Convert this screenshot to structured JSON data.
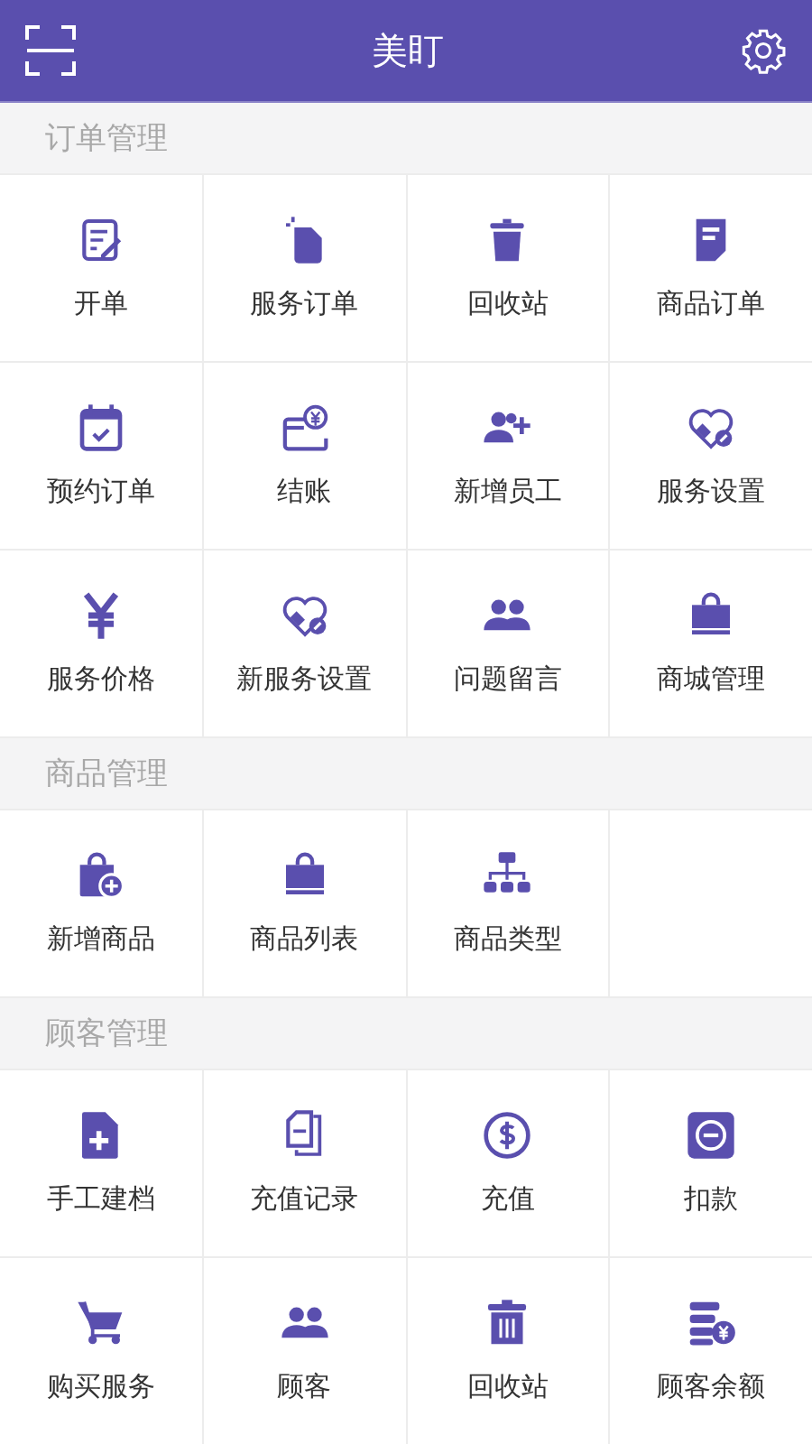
{
  "header": {
    "title": "美盯"
  },
  "sections": [
    {
      "title": "订单管理",
      "items": [
        {
          "label": "开单",
          "kind": "note"
        },
        {
          "label": "服务订单",
          "kind": "file"
        },
        {
          "label": "回收站",
          "kind": "trash"
        },
        {
          "label": "商品订单",
          "kind": "doc"
        },
        {
          "label": "预约订单",
          "kind": "calendar"
        },
        {
          "label": "结账",
          "kind": "card"
        },
        {
          "label": "新增员工",
          "kind": "userplus"
        },
        {
          "label": "服务设置",
          "kind": "heart"
        },
        {
          "label": "服务价格",
          "kind": "yen"
        },
        {
          "label": "新服务设置",
          "kind": "heart"
        },
        {
          "label": "问题留言",
          "kind": "people"
        },
        {
          "label": "商城管理",
          "kind": "bag"
        }
      ]
    },
    {
      "title": "商品管理",
      "items": [
        {
          "label": "新增商品",
          "kind": "bagplus"
        },
        {
          "label": "商品列表",
          "kind": "bag"
        },
        {
          "label": "商品类型",
          "kind": "tree"
        }
      ]
    },
    {
      "title": "顾客管理",
      "items": [
        {
          "label": "手工建档",
          "kind": "fileplus"
        },
        {
          "label": "充值记录",
          "kind": "copy"
        },
        {
          "label": "充值",
          "kind": "dollar"
        },
        {
          "label": "扣款",
          "kind": "minus"
        },
        {
          "label": "购买服务",
          "kind": "cart"
        },
        {
          "label": "顾客",
          "kind": "people"
        },
        {
          "label": "回收站",
          "kind": "bin"
        },
        {
          "label": "顾客余额",
          "kind": "coins"
        }
      ]
    }
  ]
}
